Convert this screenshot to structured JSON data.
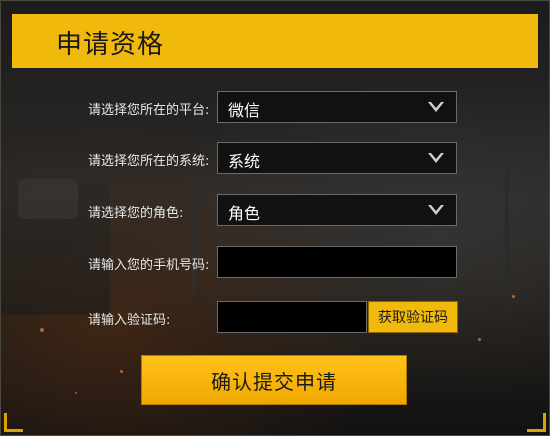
{
  "header": {
    "title": "申请资格"
  },
  "form": {
    "platform": {
      "label": "请选择您所在的平台:",
      "value": "微信"
    },
    "system": {
      "label": "请选择您所在的系统:",
      "value": "系统"
    },
    "role": {
      "label": "请选择您的角色:",
      "value": "角色"
    },
    "phone": {
      "label": "请输入您的手机号码:",
      "value": ""
    },
    "code": {
      "label": "请输入验证码:",
      "value": "",
      "button_label": "获取验证码"
    }
  },
  "submit_label": "确认提交申请",
  "colors": {
    "accent": "#f0b90b",
    "field_bg": "#000000",
    "field_border": "#6a6a6a",
    "label_text": "#e8e8e8"
  },
  "icons": {
    "dropdown": "chevron-down-icon"
  }
}
